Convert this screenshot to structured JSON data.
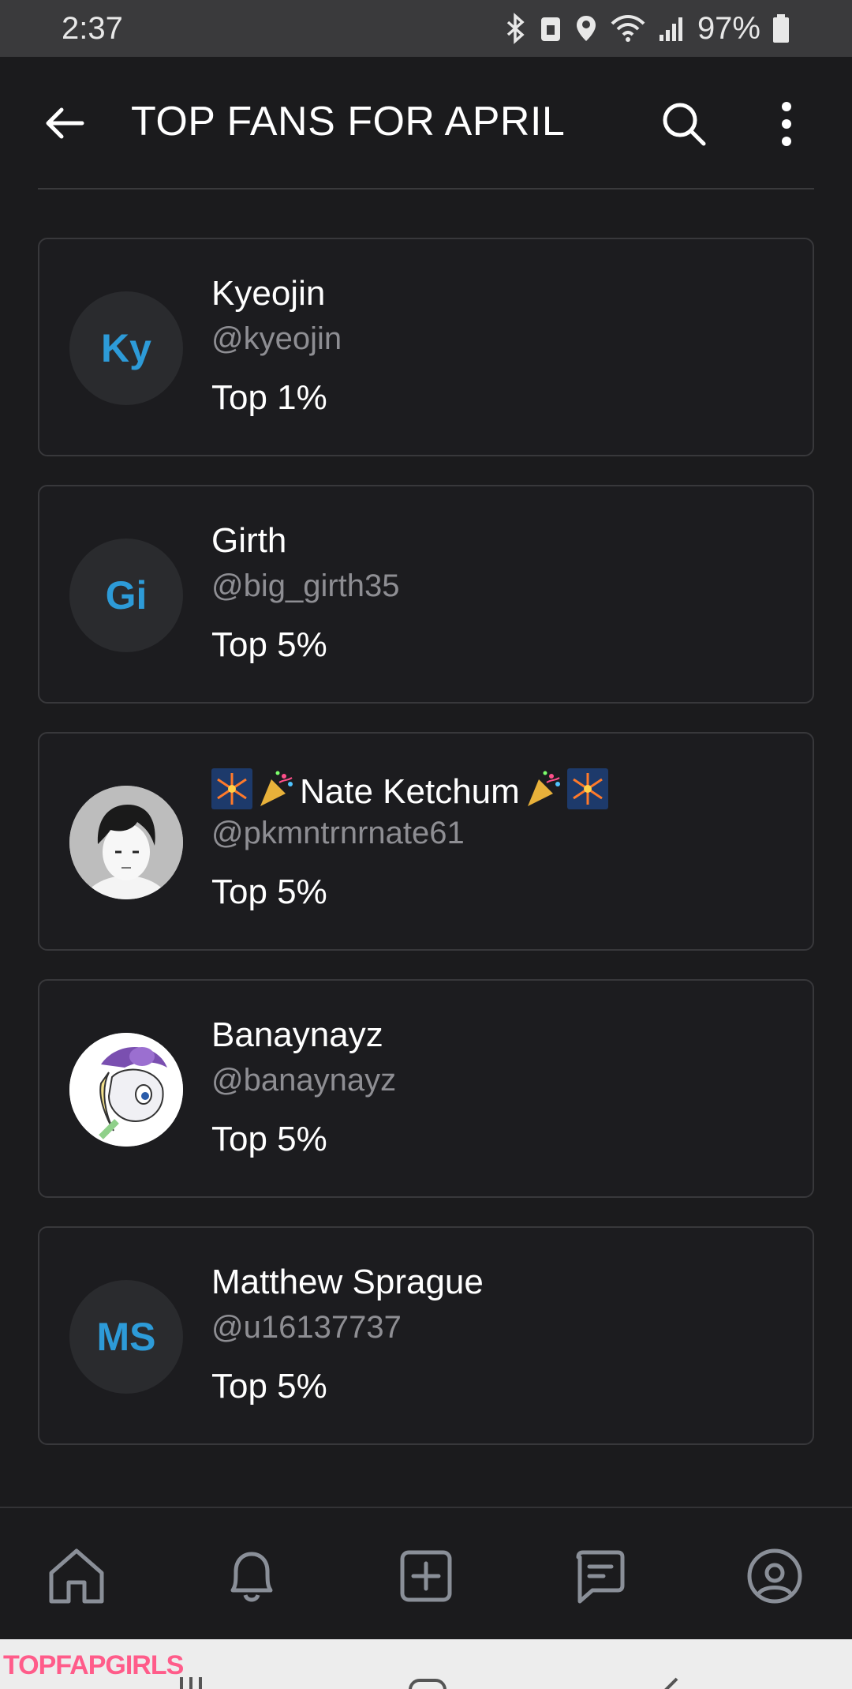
{
  "status_bar": {
    "time": "2:37",
    "battery": "97%",
    "icons": [
      "bluetooth-icon",
      "nfc-icon",
      "location-icon",
      "wifi-icon",
      "signal-icon",
      "battery-icon"
    ]
  },
  "header": {
    "title": "TOP FANS FOR APRIL",
    "back_icon": "back-arrow-icon",
    "search_icon": "search-icon",
    "more_icon": "more-vertical-icon"
  },
  "fans": [
    {
      "initials": "Ky",
      "name": "Kyeojin",
      "handle": "@kyeojin",
      "rank": "Top 1%",
      "avatar_type": "initials"
    },
    {
      "initials": "Gi",
      "name": "Girth",
      "handle": "@big_girth35",
      "rank": "Top 5%",
      "avatar_type": "initials"
    },
    {
      "initials": "",
      "name_prefix_emojis": [
        "fireworks-icon",
        "party-popper-icon"
      ],
      "name": "Nate Ketchum",
      "name_suffix_emojis": [
        "party-popper-icon",
        "fireworks-icon"
      ],
      "handle": "@pkmntrnrnate61",
      "rank": "Top 5%",
      "avatar_type": "photo"
    },
    {
      "initials": "",
      "name": "Banaynayz",
      "handle": "@banaynayz",
      "rank": "Top 5%",
      "avatar_type": "photo"
    },
    {
      "initials": "MS",
      "name": "Matthew Sprague",
      "handle": "@u16137737",
      "rank": "Top 5%",
      "avatar_type": "initials"
    }
  ],
  "bottom_nav": [
    "home-icon",
    "bell-icon",
    "add-post-icon",
    "messages-icon",
    "profile-icon"
  ],
  "watermark": "TOPFAPGIRLS",
  "colors": {
    "background": "#1b1b1d",
    "accent": "#2d9bd8",
    "card_border": "#38383b",
    "muted": "#8e8e93"
  }
}
